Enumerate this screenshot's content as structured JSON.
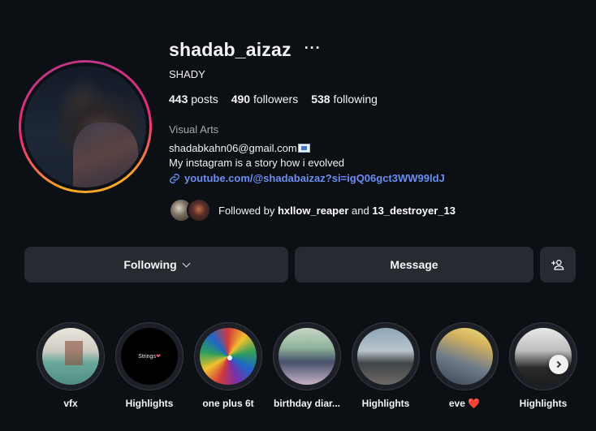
{
  "profile": {
    "username": "shadab_aizaz",
    "more_icon": "···",
    "full_name": "SHADY",
    "stats": {
      "posts_count": "443",
      "posts_label": "posts",
      "followers_count": "490",
      "followers_label": "followers",
      "following_count": "538",
      "following_label": "following"
    },
    "category": "Visual Arts",
    "bio_email": "shadabkahn06@gmail.com",
    "bio_line2": "My instagram is a story how i evolved",
    "link": "youtube.com/@shadabaizaz?si=igQ06gct3WW99ldJ",
    "followed_by_prefix": "Followed by ",
    "followed_by_user1": "hxllow_reaper",
    "followed_by_and": " and ",
    "followed_by_user2": "13_destroyer_13"
  },
  "actions": {
    "following_label": "Following",
    "message_label": "Message",
    "add_user_icon": "person-plus-icon"
  },
  "highlights": [
    {
      "label": "vfx"
    },
    {
      "label": "Highlights",
      "cover_text": "Strings",
      "cover_heart": "❤"
    },
    {
      "label": "one plus 6t"
    },
    {
      "label": "birthday diar..."
    },
    {
      "label": "Highlights"
    },
    {
      "label": "eve ❤️"
    },
    {
      "label": "Highlights"
    }
  ],
  "colors": {
    "background": "#0c0f14",
    "button": "#262a31",
    "link": "#6b8ef2",
    "story_ring_start": "#f9a826",
    "story_ring_end": "#c13584"
  }
}
